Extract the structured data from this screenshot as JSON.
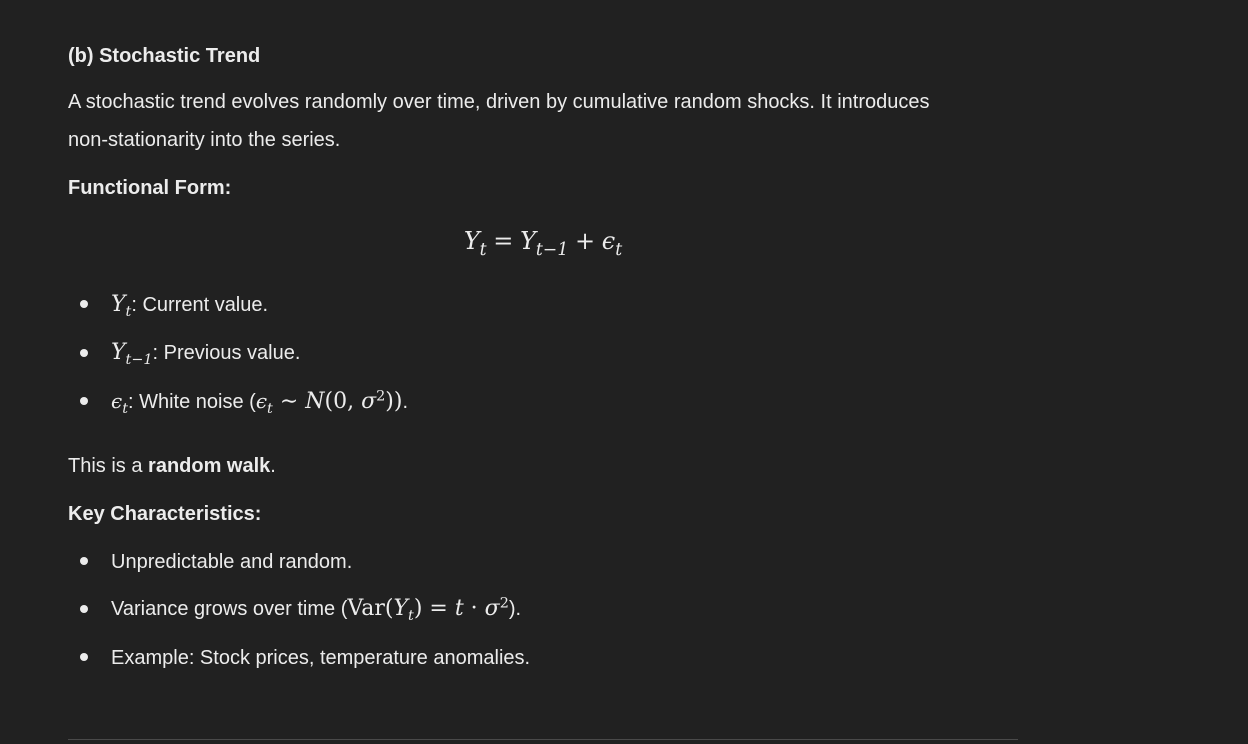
{
  "section": {
    "heading": "(b) Stochastic Trend",
    "intro_line1": "A stochastic trend evolves randomly over time, driven by cumulative random shocks. It introduces",
    "intro_line2": "non-stationarity into the series.",
    "functional_form_label": "Functional Form:",
    "equation": {
      "Y": "Y",
      "t": "t",
      "eq": "=",
      "t_minus_1": "t−1",
      "plus": "+",
      "eps": "ϵ"
    },
    "definitions": [
      {
        "sym": "Y",
        "sub": "t",
        "text": ": Current value."
      },
      {
        "sym": "Y",
        "sub": "t−1",
        "text": ": Previous value."
      },
      {
        "sym": "ϵ",
        "sub": "t",
        "text": ": White noise (",
        "dist_sym": "ϵ",
        "dist_sub": "t",
        "tilde": " ∼ ",
        "N": "N",
        "args": "(0, ",
        "sigma": "σ",
        "sup": "2",
        "close": "))",
        "end": "."
      }
    ],
    "random_walk_prefix": "This is a ",
    "random_walk_bold": "random walk",
    "random_walk_suffix": ".",
    "key_label": "Key Characteristics:",
    "characteristics": [
      {
        "text": "Unpredictable and random."
      },
      {
        "text": "Variance grows over time (",
        "var": "Var",
        "open": "(",
        "Y": "Y",
        "sub": "t",
        "close": ")",
        "eq": " = ",
        "t": "t",
        "dot": " · ",
        "sigma": "σ",
        "sup": "2",
        "end": ")."
      },
      {
        "text": "Example: Stock prices, temperature anomalies."
      }
    ]
  }
}
